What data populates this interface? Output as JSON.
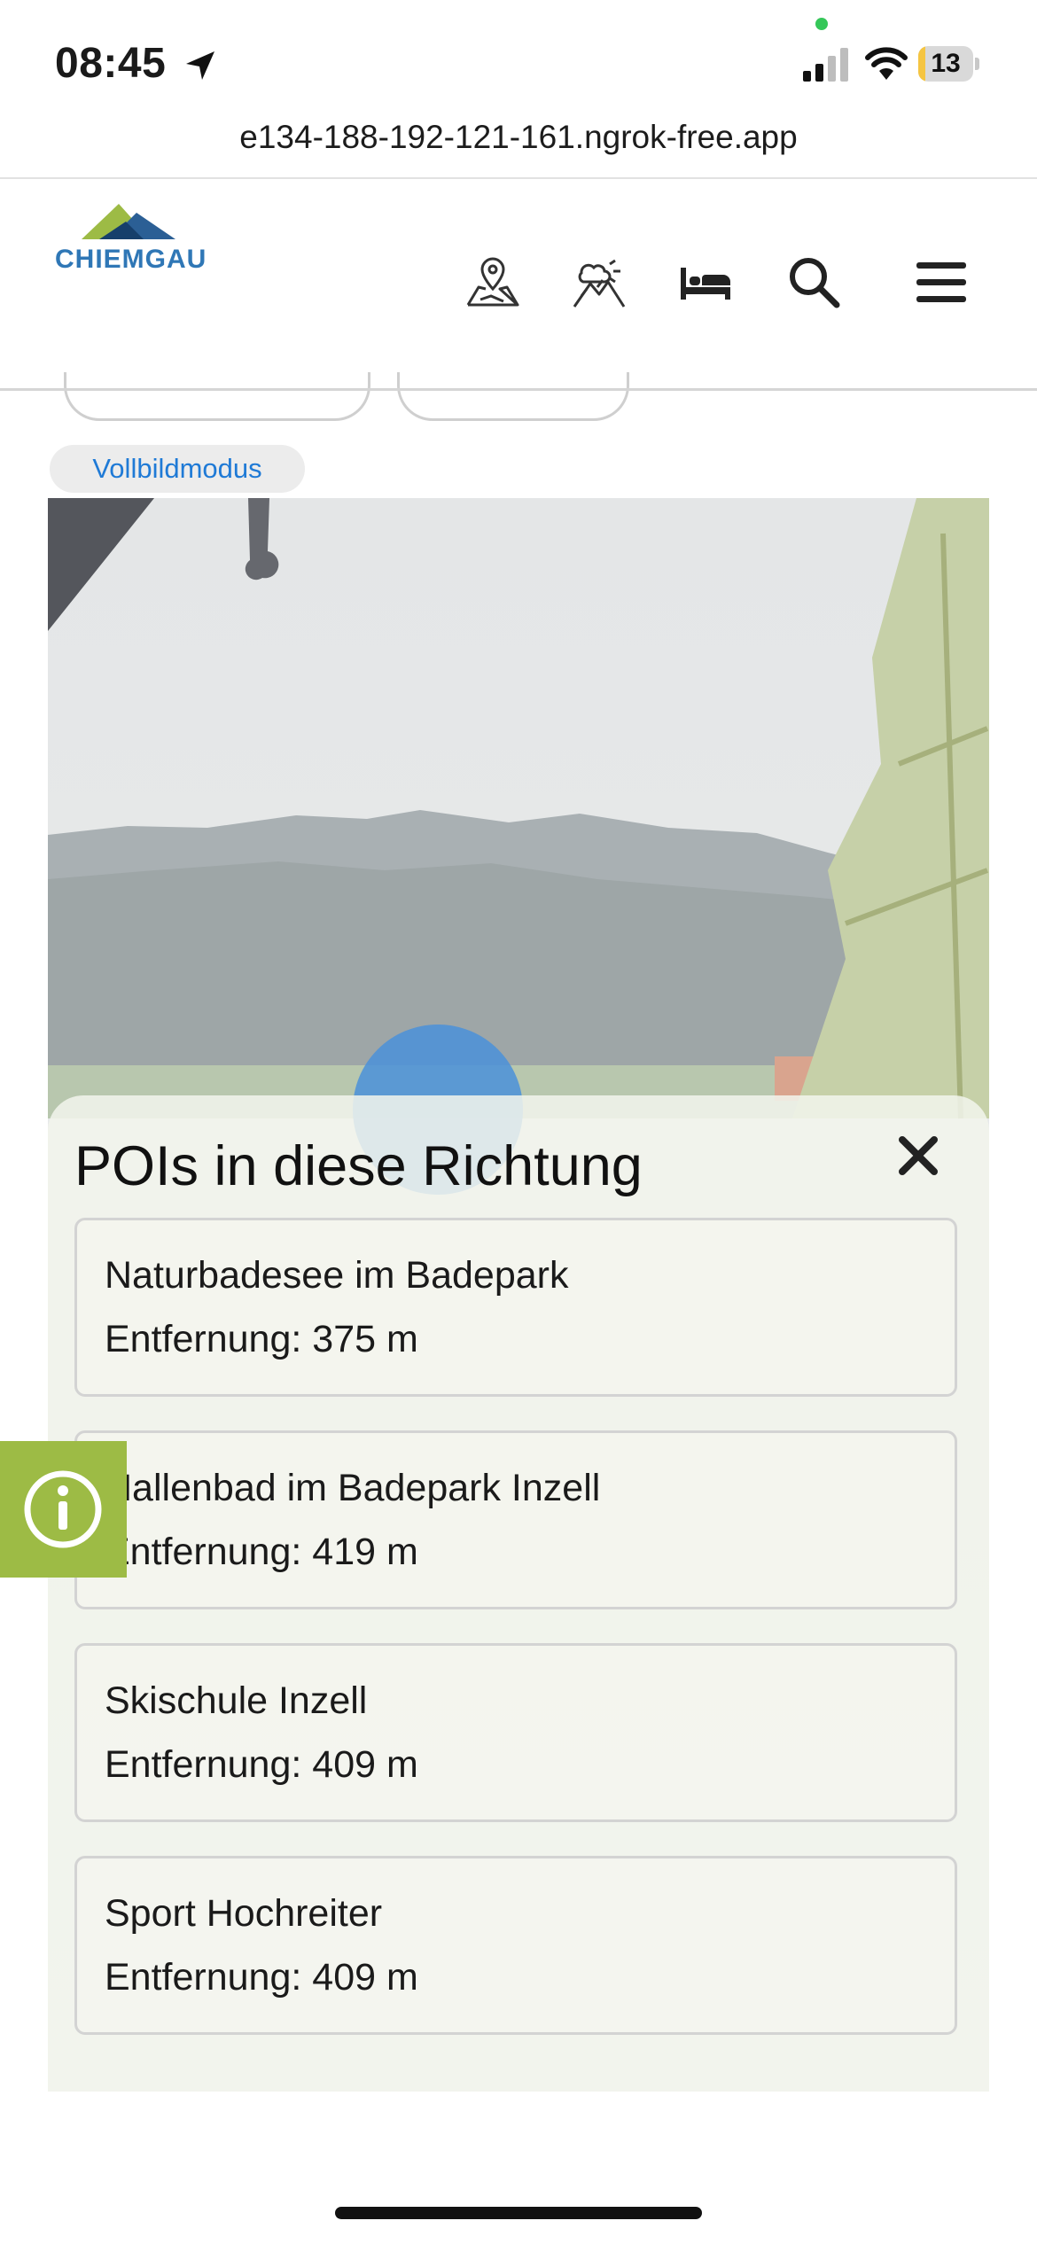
{
  "status_bar": {
    "time": "08:45",
    "battery": "13",
    "battery_level": 0.13
  },
  "browser": {
    "url": "e134-188-192-121-161.ngrok-free.app"
  },
  "header": {
    "logo_text": "CHIEMGAU",
    "nav_icons": [
      "map-location-icon",
      "weather-mountain-icon",
      "bed-icon",
      "search-icon",
      "menu-icon"
    ]
  },
  "page": {
    "fullscreen_label": "Vollbildmodus"
  },
  "poi_panel": {
    "title": "POIs in diese Richtung",
    "items": [
      {
        "name": "Naturbadesee im Badepark",
        "distance": "Entfernung: 375 m"
      },
      {
        "name": "Hallenbad im Badepark Inzell",
        "distance": "Entfernung: 419 m"
      },
      {
        "name": "Skischule Inzell",
        "distance": "Entfernung: 409 m"
      },
      {
        "name": "Sport Hochreiter",
        "distance": "Entfernung: 409 m"
      }
    ]
  },
  "colors": {
    "accent_blue": "#1f7ad6",
    "brand_green": "#9dbb45",
    "logo_blue": "#2f77b6"
  }
}
